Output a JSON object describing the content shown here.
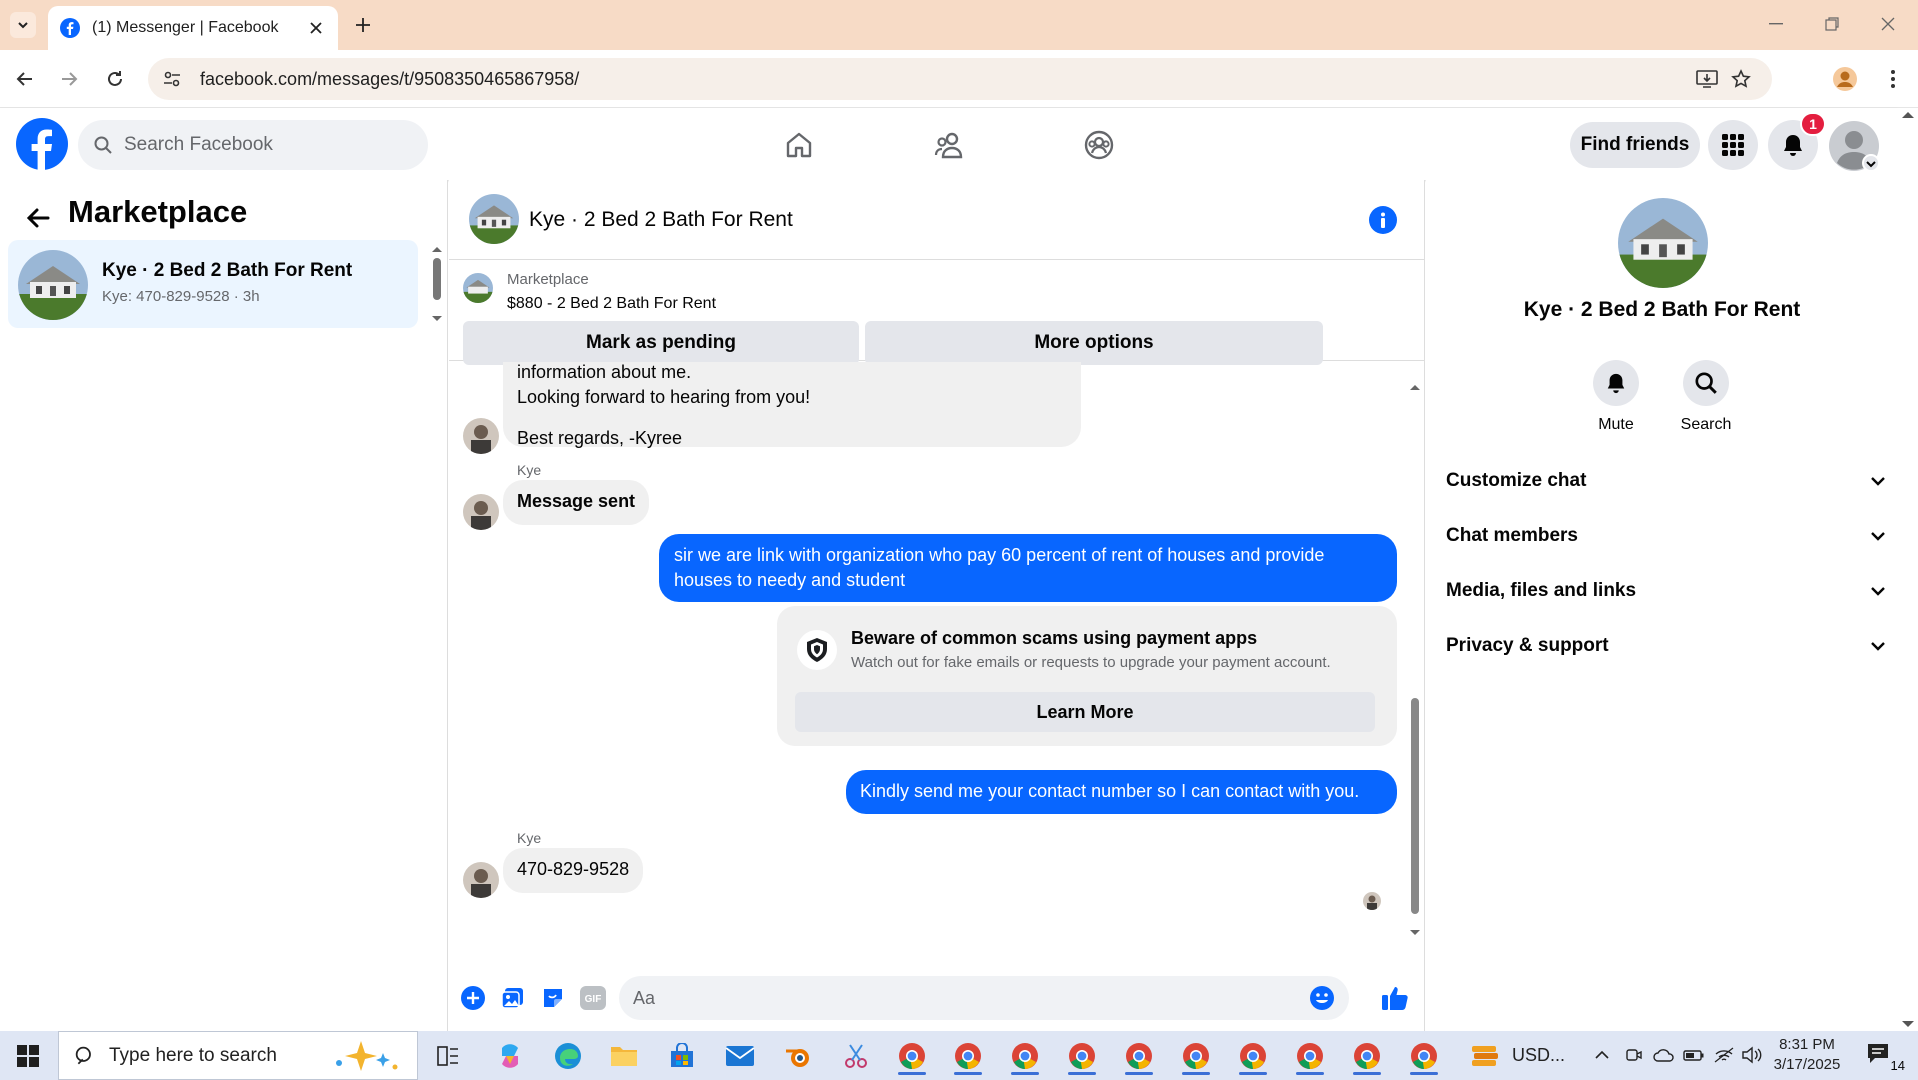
{
  "browser": {
    "tab_title": "(1) Messenger | Facebook",
    "url": "facebook.com/messages/t/9508350465867958/"
  },
  "fb_header": {
    "search_placeholder": "Search Facebook",
    "find_friends_label": "Find friends",
    "notification_count": "1",
    "brand_color": "#0866ff"
  },
  "left_panel": {
    "title": "Marketplace",
    "conversations": [
      {
        "name": "Kye · 2 Bed 2 Bath For Rent",
        "subtitle": "Kye: 470-829-9528 · 3h"
      }
    ]
  },
  "chat": {
    "title": "Kye · 2 Bed 2 Bath For Rent",
    "marketplace_label": "Marketplace",
    "listing": "$880 - 2 Bed 2 Bath For Rent",
    "mark_pending_label": "Mark as pending",
    "more_options_label": "More options",
    "messages": {
      "m1_line1": "information about me.",
      "m1_line2": "Looking forward to hearing from you!",
      "m1_line3": "Best regards, -Kyree",
      "m2_sender": "Kye",
      "m2_text": "Message sent",
      "m3_line1": "sir we are link with organization who pay 60 percent of rent of houses and provide",
      "m3_line2": "houses to needy  and student",
      "m4_text": "Kindly send me your contact number so I can contact with you.",
      "m5_sender": "Kye",
      "m5_text": "470-829-9528"
    },
    "scam_notice": {
      "title": "Beware of common scams using payment apps",
      "description": "Watch out for fake emails or requests to upgrade your payment account.",
      "button": "Learn More"
    },
    "composer_placeholder": "Aa"
  },
  "right_panel": {
    "name": "Kye · 2 Bed 2 Bath For Rent",
    "actions": [
      "Mute",
      "Search"
    ],
    "sections": [
      "Customize chat",
      "Chat members",
      "Media, files and links",
      "Privacy & support"
    ]
  },
  "taskbar": {
    "search_placeholder": "Type here to search",
    "currency_widget": "USD...",
    "time": "8:31 PM",
    "date": "3/17/2025",
    "notification_count": "14"
  }
}
